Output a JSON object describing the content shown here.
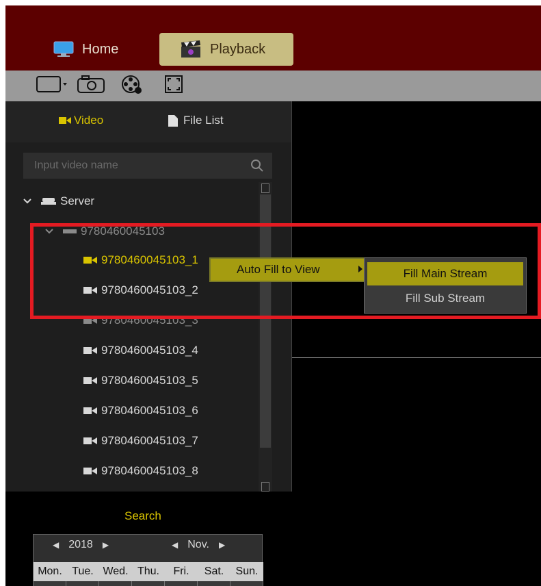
{
  "tabs": {
    "home": "Home",
    "playback": "Playback"
  },
  "toolbar": {
    "icons": [
      "window-layout-icon",
      "camera-snapshot-icon",
      "video-reel-icon",
      "fullscreen-icon"
    ]
  },
  "panel": {
    "tab_video": "Video",
    "tab_file_list": "File List",
    "search_placeholder": "Input video name",
    "tree": {
      "root": "Server",
      "device": "9780460045103",
      "channels": [
        "9780460045103_1",
        "9780460045103_2",
        "9780460045103_3",
        "9780460045103_4",
        "9780460045103_5",
        "9780460045103_6",
        "9780460045103_7",
        "9780460045103_8"
      ]
    }
  },
  "search_section": {
    "title": "Search",
    "year": "2018",
    "month": "Nov.",
    "weekdays": [
      "Mon.",
      "Tue.",
      "Wed.",
      "Thu.",
      "Fri.",
      "Sat.",
      "Sun."
    ]
  },
  "context_menu": {
    "item": "Auto Fill to View",
    "submenu": [
      "Fill Main Stream",
      "Fill Sub Stream"
    ]
  },
  "colors": {
    "title_bar": "#5c0000",
    "accent": "#d9c400",
    "selected_menu": "#a59c10",
    "highlight_box": "#e41b22"
  }
}
